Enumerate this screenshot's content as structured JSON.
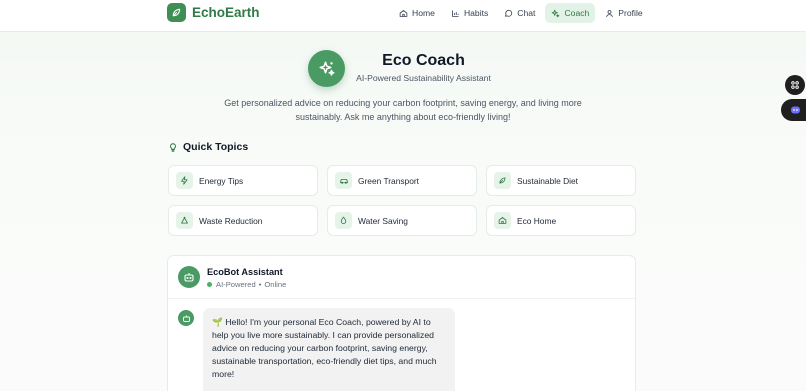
{
  "app": {
    "name": "EchoEarth"
  },
  "nav": [
    {
      "label": "Home",
      "icon": "home-icon"
    },
    {
      "label": "Habits",
      "icon": "chart-icon"
    },
    {
      "label": "Chat",
      "icon": "message-icon"
    },
    {
      "label": "Coach",
      "icon": "sparkle-icon",
      "active": true
    },
    {
      "label": "Profile",
      "icon": "user-icon"
    }
  ],
  "hero": {
    "title": "Eco Coach",
    "subtitle": "AI-Powered Sustainability Assistant",
    "description": "Get personalized advice on reducing your carbon footprint, saving energy, and living more sustainably. Ask me anything about eco-friendly living!"
  },
  "quick_topics": {
    "heading": "Quick Topics",
    "items": [
      {
        "label": "Energy Tips",
        "icon": "bolt-icon"
      },
      {
        "label": "Green Transport",
        "icon": "car-icon"
      },
      {
        "label": "Sustainable Diet",
        "icon": "leaf-icon"
      },
      {
        "label": "Waste Reduction",
        "icon": "recycle-icon"
      },
      {
        "label": "Water Saving",
        "icon": "droplet-icon"
      },
      {
        "label": "Eco Home",
        "icon": "house-icon"
      }
    ]
  },
  "chat": {
    "bot_name": "EcoBot Assistant",
    "status_powered": "AI-Powered",
    "status_separator": "•",
    "status_online": "Online",
    "first_message": "🌱 Hello! I'm your personal Eco Coach, powered by AI to help you live more sustainably. I can provide personalized advice on reducing your carbon footprint, saving energy, sustainable transportation, eco-friendly diet tips, and much more!"
  },
  "colors": {
    "accent": "#4a9a63",
    "accent_dark": "#2f7a45",
    "accent_soft": "#e3f2e6"
  }
}
